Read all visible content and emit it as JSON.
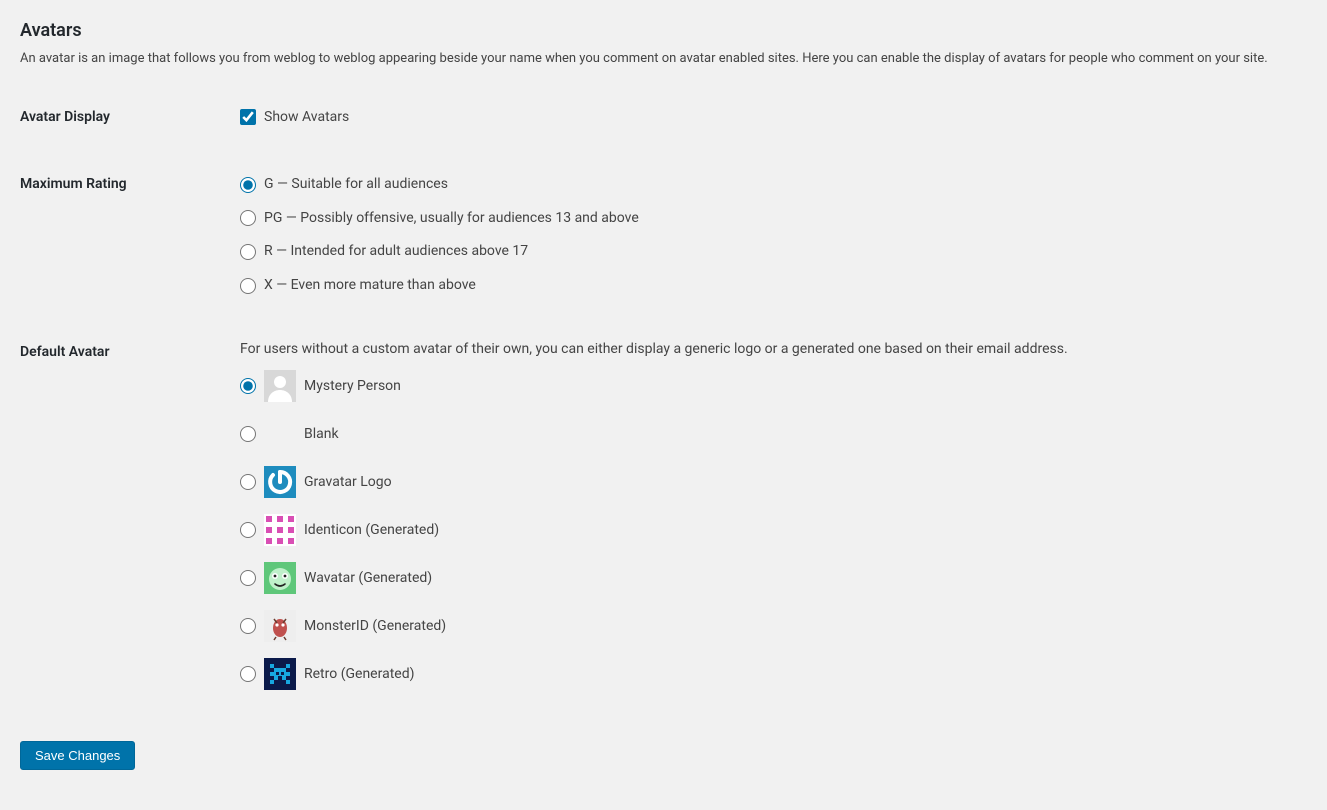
{
  "section": {
    "title": "Avatars",
    "description": "An avatar is an image that follows you from weblog to weblog appearing beside your name when you comment on avatar enabled sites. Here you can enable the display of avatars for people who comment on your site."
  },
  "avatar_display": {
    "label": "Avatar Display",
    "checkbox_label": "Show Avatars",
    "checked": true
  },
  "maximum_rating": {
    "label": "Maximum Rating",
    "selected": "g",
    "options": {
      "g": "G — Suitable for all audiences",
      "pg": "PG — Possibly offensive, usually for audiences 13 and above",
      "r": "R — Intended for adult audiences above 17",
      "x": "X — Even more mature than above"
    }
  },
  "default_avatar": {
    "label": "Default Avatar",
    "description": "For users without a custom avatar of their own, you can either display a generic logo or a generated one based on their email address.",
    "selected": "mystery",
    "options": {
      "mystery": "Mystery Person",
      "blank": "Blank",
      "gravatar": "Gravatar Logo",
      "identicon": "Identicon (Generated)",
      "wavatar": "Wavatar (Generated)",
      "monsterid": "MonsterID (Generated)",
      "retro": "Retro (Generated)"
    }
  },
  "buttons": {
    "save": "Save Changes"
  }
}
